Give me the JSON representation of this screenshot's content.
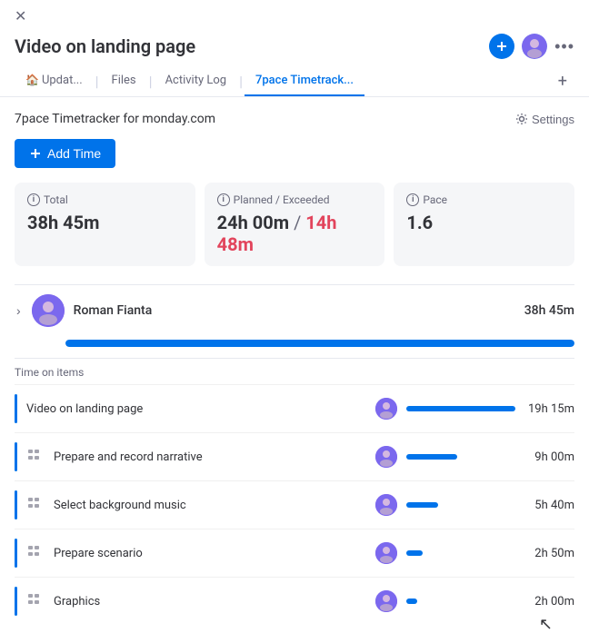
{
  "window": {
    "title": "Video on landing page"
  },
  "topbar": {
    "close_label": "✕"
  },
  "title_actions": {
    "add_person_icon": "+",
    "more_icon": "•••"
  },
  "tabs": [
    {
      "id": "updates",
      "label": "Updat...",
      "icon": "🏠",
      "active": false
    },
    {
      "id": "files",
      "label": "Files",
      "active": false
    },
    {
      "id": "activity",
      "label": "Activity Log",
      "active": false
    },
    {
      "id": "timetrack",
      "label": "7pace Timetrack...",
      "active": true
    }
  ],
  "tab_add_label": "+",
  "tracker": {
    "title": "7pace Timetracker for monday.com",
    "settings_label": "Settings"
  },
  "add_time_button": "+ Add Time",
  "stats": [
    {
      "id": "total",
      "label": "Total",
      "value": "38h 45m",
      "value_type": "plain"
    },
    {
      "id": "planned",
      "label": "Planned / Exceeded",
      "value_planned": "24h 00m",
      "value_exceeded": "14h 48m",
      "value_type": "split"
    },
    {
      "id": "pace",
      "label": "Pace",
      "value": "1.6",
      "value_type": "plain"
    }
  ],
  "person": {
    "name": "Roman Fianta",
    "time": "38h 45m",
    "progress_pct": 100
  },
  "time_on_items_label": "Time on items",
  "items": [
    {
      "name": "Video on landing page",
      "type": "parent",
      "time": "19h 15m",
      "bar_pct": 100
    },
    {
      "name": "Prepare and record narrative",
      "type": "child",
      "time": "9h 00m",
      "bar_pct": 47
    },
    {
      "name": "Select background music",
      "type": "child",
      "time": "5h 40m",
      "bar_pct": 29
    },
    {
      "name": "Prepare scenario",
      "type": "child",
      "time": "2h 50m",
      "bar_pct": 15
    },
    {
      "name": "Graphics",
      "type": "child",
      "time": "2h 00m",
      "bar_pct": 10
    }
  ]
}
